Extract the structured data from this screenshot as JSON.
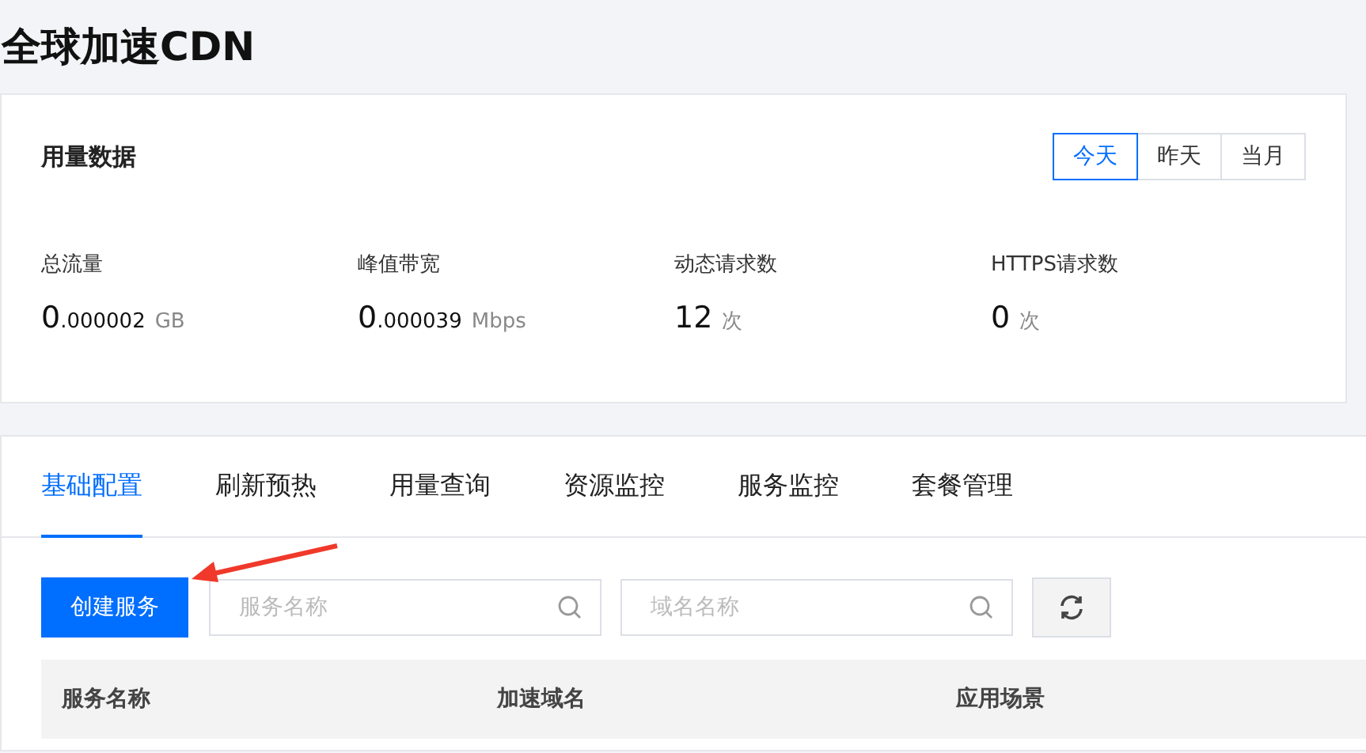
{
  "page_title": "全球加速CDN",
  "usage": {
    "title": "用量数据",
    "periods": [
      {
        "label": "今天",
        "selected": true
      },
      {
        "label": "昨天",
        "selected": false
      },
      {
        "label": "当月",
        "selected": false
      }
    ],
    "metrics": [
      {
        "label": "总流量",
        "value": "0",
        "fraction": ".000002",
        "unit": "GB"
      },
      {
        "label": "峰值带宽",
        "value": "0",
        "fraction": ".000039",
        "unit": "Mbps"
      },
      {
        "label": "动态请求数",
        "value": "12",
        "unit": "次"
      },
      {
        "label": "HTTPS请求数",
        "value": "0",
        "unit": "次"
      }
    ]
  },
  "tabs": [
    {
      "label": "基础配置",
      "selected": true
    },
    {
      "label": "刷新预热",
      "selected": false
    },
    {
      "label": "用量查询",
      "selected": false
    },
    {
      "label": "资源监控",
      "selected": false
    },
    {
      "label": "服务监控",
      "selected": false
    },
    {
      "label": "套餐管理",
      "selected": false
    }
  ],
  "toolbar": {
    "create_button": "创建服务",
    "service_search": {
      "placeholder": "服务名称"
    },
    "domain_search": {
      "placeholder": "域名名称"
    }
  },
  "table": {
    "columns": [
      "服务名称",
      "加速域名",
      "应用场景"
    ]
  }
}
